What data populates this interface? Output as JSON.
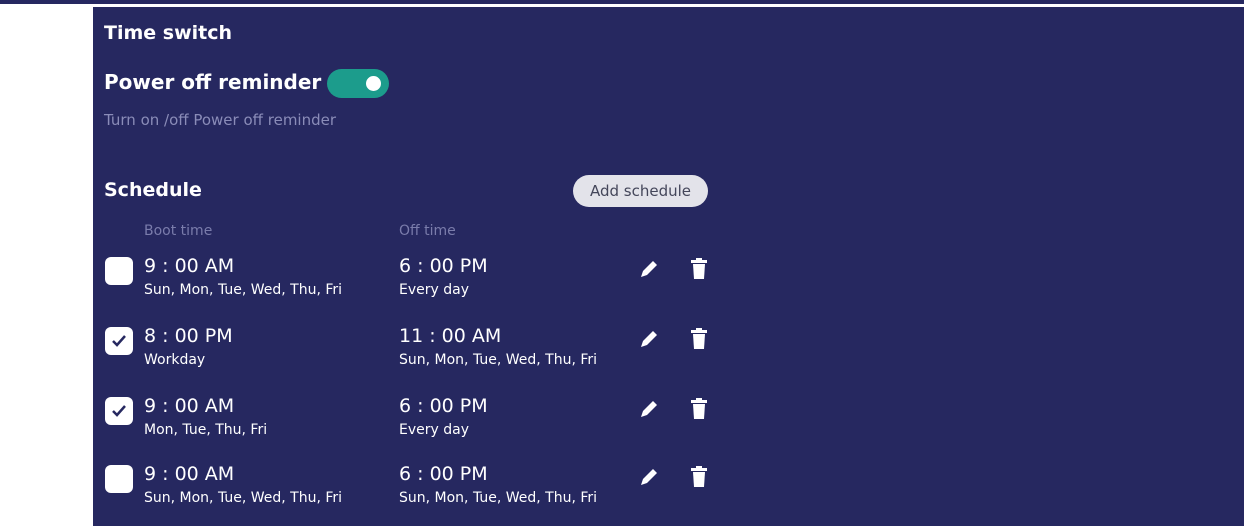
{
  "time_switch": {
    "title": "Time switch",
    "power_off_reminder": {
      "label": "Power off reminder",
      "enabled": true,
      "description": "Turn on /off Power off reminder"
    },
    "accent_color": "#1c9c8c",
    "background_color": "#262860"
  },
  "schedule": {
    "title": "Schedule",
    "add_button_label": "Add schedule",
    "columns": {
      "boot": "Boot time",
      "off": "Off time"
    },
    "rows": [
      {
        "checked": false,
        "boot_time": "9 : 00 AM",
        "boot_days": "Sun, Mon, Tue, Wed, Thu, Fri",
        "off_time": "6 : 00 PM",
        "off_days": "Every day"
      },
      {
        "checked": true,
        "boot_time": "8 : 00 PM",
        "boot_days": "Workday",
        "off_time": "11 : 00 AM",
        "off_days": "Sun, Mon, Tue, Wed, Thu, Fri"
      },
      {
        "checked": true,
        "boot_time": "9 : 00 AM",
        "boot_days": "Mon, Tue, Thu, Fri",
        "off_time": "6 : 00 PM",
        "off_days": "Every day"
      },
      {
        "checked": false,
        "boot_time": "9 : 00 AM",
        "boot_days": "Sun, Mon, Tue, Wed, Thu, Fri",
        "off_time": "6 : 00 PM",
        "off_days": "Sun, Mon, Tue, Wed, Thu, Fri"
      }
    ],
    "icons": {
      "edit": "pencil-icon",
      "delete": "trash-icon"
    }
  }
}
